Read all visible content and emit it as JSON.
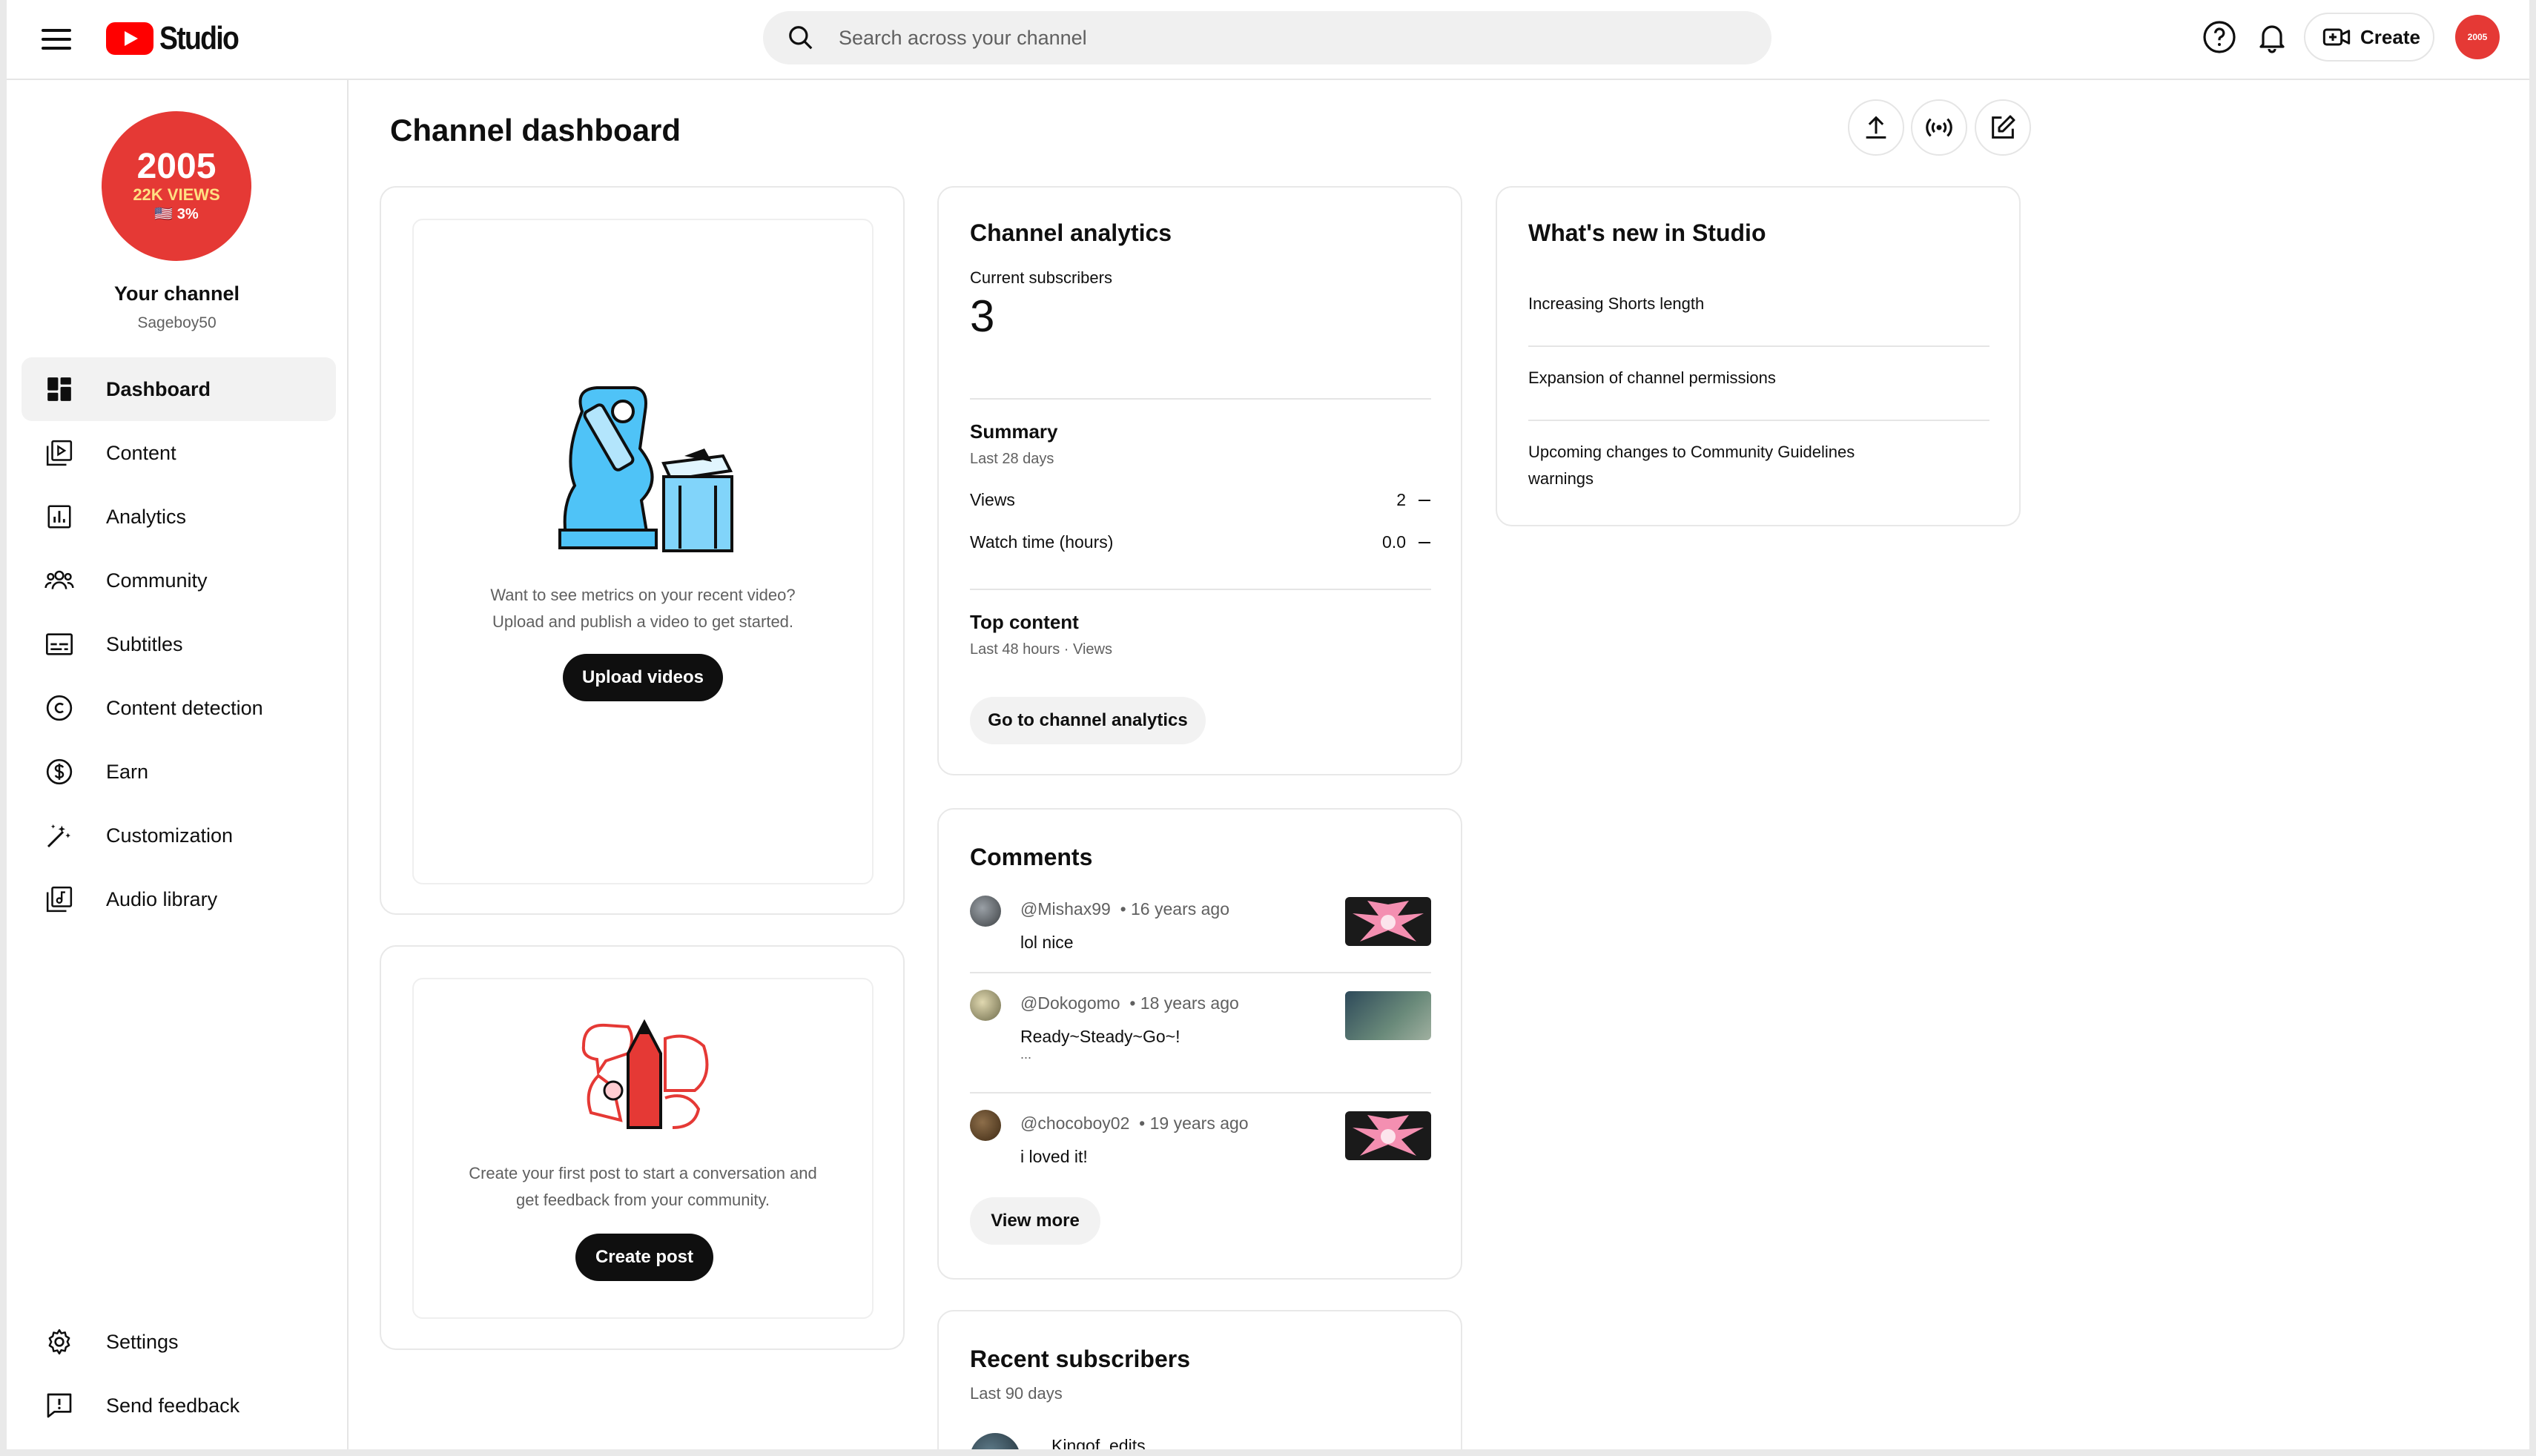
{
  "app": {
    "logo_text": "Studio",
    "brand_color": "#ff0000"
  },
  "search": {
    "placeholder": "Search across your channel"
  },
  "topbar": {
    "create_label": "Create"
  },
  "avatar": {
    "line1": "2005",
    "line2": "22K VIEWS",
    "line3": "🇺🇸 3%"
  },
  "channel": {
    "title": "Your channel",
    "handle": "Sageboy50"
  },
  "nav": {
    "dashboard": "Dashboard",
    "content": "Content",
    "analytics": "Analytics",
    "community": "Community",
    "subtitles": "Subtitles",
    "content_detection": "Content detection",
    "earn": "Earn",
    "customization": "Customization",
    "audio_library": "Audio library",
    "settings": "Settings",
    "send_feedback": "Send feedback"
  },
  "page": {
    "title": "Channel dashboard"
  },
  "video_card": {
    "line1": "Want to see metrics on your recent video?",
    "line2": "Upload and publish a video to get started.",
    "button": "Upload videos"
  },
  "post_card": {
    "line1": "Create your first post to start a conversation and",
    "line2": "get feedback from your community.",
    "button": "Create post"
  },
  "analytics": {
    "title": "Channel analytics",
    "subs_label": "Current subscribers",
    "subs_value": "3",
    "summary_title": "Summary",
    "summary_period": "Last 28 days",
    "rows": [
      {
        "label": "Views",
        "value": "2"
      },
      {
        "label": "Watch time (hours)",
        "value": "0.0"
      }
    ],
    "top_title": "Top content",
    "top_period": "Last 48 hours · Views",
    "button": "Go to channel analytics"
  },
  "comments": {
    "title": "Comments",
    "items": [
      {
        "user": "@Mishax99",
        "time": "• 16 years ago",
        "text": "lol nice",
        "extra": ""
      },
      {
        "user": "@Dokogomo",
        "time": "• 18 years ago",
        "text": "Ready~Steady~Go~!",
        "extra": "..."
      },
      {
        "user": "@chocoboy02",
        "time": "• 19 years ago",
        "text": "i loved it!",
        "extra": ""
      }
    ],
    "button": "View more"
  },
  "recent_subs": {
    "title": "Recent subscribers",
    "period": "Last 90 days",
    "first_name": "Kingof_edits"
  },
  "whats_new": {
    "title": "What's new in Studio",
    "items": [
      "Increasing Shorts length",
      "Expansion of channel permissions",
      "Upcoming changes to Community Guidelines warnings"
    ]
  }
}
